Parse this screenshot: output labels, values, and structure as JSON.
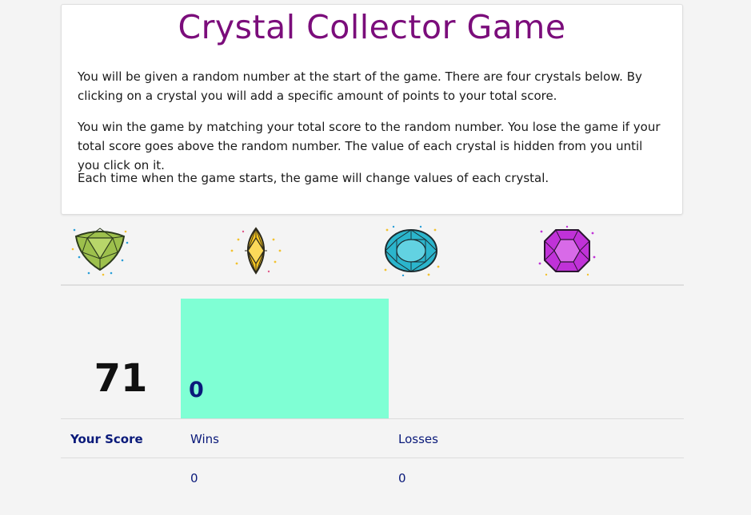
{
  "page": {
    "title": "Crystal Collector Game",
    "instructions": [
      "You will be given a random number at the start of the game. There are four crystals below. By clicking on a crystal you will add a specific amount of points to your total score.",
      "You win the game by matching your total score to the random number. You lose the game if your total score goes above the random number. The value of each crystal is hidden from you until you click on it.",
      "Each time when the game starts, the game will change values of each crystal."
    ]
  },
  "crystals": [
    {
      "name": "green-crystal",
      "color": "#9dc04c"
    },
    {
      "name": "yellow-crystal",
      "color": "#f7c51e"
    },
    {
      "name": "blue-crystal",
      "color": "#2bb5cc"
    },
    {
      "name": "purple-crystal",
      "color": "#c032d8"
    }
  ],
  "game": {
    "random_number": "71",
    "total_score": "0"
  },
  "stats": {
    "your_score_label": "Your Score",
    "wins_label": "Wins",
    "losses_label": "Losses",
    "wins_value": "0",
    "losses_value": "0"
  },
  "colors": {
    "title": "#7b0d7b",
    "score_box": "#7fffd4",
    "stats_text": "#0a1a7a"
  }
}
